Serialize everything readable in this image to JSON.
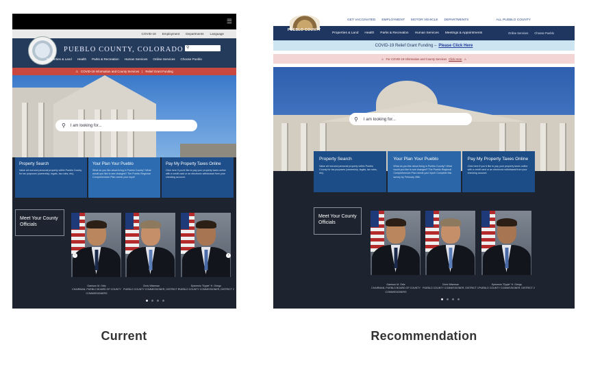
{
  "captions": {
    "current": "Current",
    "recommendation": "Recommendation"
  },
  "current": {
    "menu_icon": "hamburger-icon",
    "utility_links": [
      "COVID-19",
      "Employment",
      "Departments",
      "Language"
    ],
    "site_title": "PUEBLO COUNTY, COLORADO",
    "nav": [
      "Properties & Land",
      "Health",
      "Parks & Recreation",
      "Human Services",
      "Online Services",
      "Choose Pueblo"
    ],
    "alert": {
      "text": "COVID-19 Information and County Services",
      "link": "Relief Grant Funding"
    },
    "search_placeholder": "I am looking for...",
    "tiles": [
      {
        "title": "Property Search",
        "text": "Value all real and personal property within Pueblo County for tax purposes (ownership, legals, tax roles, etc)."
      },
      {
        "title": "Your Plan Your Pueblo",
        "text": "What do you like about living in Pueblo County? What would you like to see changed? The Pueblo Regional Comprehensive Plan needs your input!"
      },
      {
        "title": "Pay My Property Taxes Online",
        "text": "Click here if you'd like to pay your property taxes online with a credit card or an electronic withdrawal from your checking account."
      }
    ],
    "meet_label": "Meet Your County Officials",
    "officials": [
      {
        "name": "Garrison M. Ortiz",
        "role": "CHAIRMAN, PUEBLO BOARD OF COUNTY COMMISSIONERS"
      },
      {
        "name": "Chris Wiseman",
        "role": "PUEBLO COUNTY COMMISSIONER, DISTRICT 1"
      },
      {
        "name": "Epimenio \"Eppie\" H. Griego",
        "role": "PUEBLO COUNTY COMMISSIONER, DISTRICT 2"
      }
    ]
  },
  "recommendation": {
    "top_links": [
      "GET VACCINATED",
      "EMPLOYMENT",
      "MOTOR VEHICLE",
      "DEPARTMENTS"
    ],
    "county_selector": "ALL PUEBLO COUNTY",
    "logo_text": "PUEBLO COUNTY",
    "nav": [
      "Properties & Land",
      "Health",
      "Parks & Recreation",
      "Human Services",
      "Meetings & Appointments"
    ],
    "nav_secondary": [
      "Online Services",
      "Choose Pueblo"
    ],
    "covid_banner": {
      "text": "COVID-19 Relief Grant Funding –",
      "link": "Please Click Here"
    },
    "alert": {
      "text": "For COVID-19 Information and County Services",
      "link": "Click Here"
    },
    "search_placeholder": "I am looking for...",
    "tiles": [
      {
        "title": "Property Search",
        "text": "Value all real and personal property within Pueblo County for tax purposes (ownership, legals, tax roles, etc)."
      },
      {
        "title": "Your Plan Your Pueblo",
        "text": "What do you like about living in Pueblo County? What would you like to see changed? The Pueblo Regional Comprehensive Plan needs your input! Complete this survey by February 28th."
      },
      {
        "title": "Pay My Property Taxes Online",
        "text": "Click here if you'd like to pay your property taxes online with a credit card or an electronic withdrawal from your checking account."
      }
    ],
    "meet_label": "Meet Your County Officials",
    "officials": [
      {
        "name": "Garrison M. Ortiz",
        "role": "CHAIRMAN, PUEBLO BOARD OF COUNTY COMMISSIONERS"
      },
      {
        "name": "Chris Wiseman",
        "role": "PUEBLO COUNTY COMMISSIONER, DISTRICT 1"
      },
      {
        "name": "Epimenio \"Eppie\" H. Griego",
        "role": "PUEBLO COUNTY COMMISSIONER, DISTRICT 2"
      }
    ]
  }
}
